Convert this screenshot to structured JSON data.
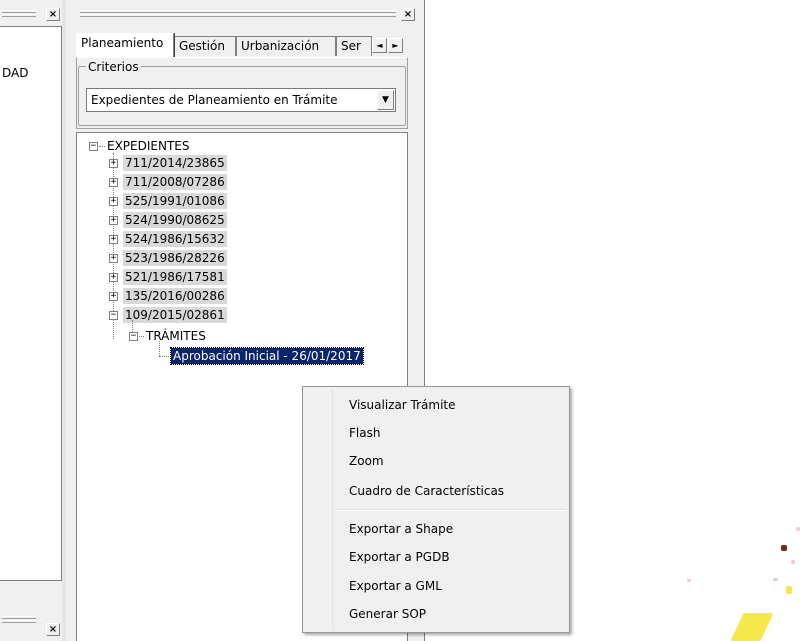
{
  "left_pane": {
    "close_glyph": "×",
    "clipped_text": "DAD"
  },
  "middle_pane": {
    "close_glyph": "×",
    "tabs": [
      {
        "label": "Planeamiento",
        "active": true
      },
      {
        "label": "Gestión",
        "active": false
      },
      {
        "label": "Urbanización",
        "active": false
      },
      {
        "label": "Ser",
        "active": false
      }
    ],
    "tab_scroll_left": "◄",
    "tab_scroll_right": "►",
    "criteria": {
      "group_label": "Criterios",
      "selected": "Expedientes de Planeamiento en Trámite",
      "dropdown_glyph": "▼"
    },
    "tree": {
      "root": {
        "label": "EXPEDIENTES",
        "toggle": "−"
      },
      "items": [
        {
          "label": "711/2014/23865",
          "toggle": "+"
        },
        {
          "label": "711/2008/07286",
          "toggle": "+"
        },
        {
          "label": "525/1991/01086",
          "toggle": "+"
        },
        {
          "label": "524/1990/08625",
          "toggle": "+"
        },
        {
          "label": "524/1986/15632",
          "toggle": "+"
        },
        {
          "label": "523/1986/28226",
          "toggle": "+"
        },
        {
          "label": "521/1986/17581",
          "toggle": "+"
        },
        {
          "label": "135/2016/00286",
          "toggle": "+"
        },
        {
          "label": "109/2015/02861",
          "toggle": "−"
        }
      ],
      "subfolder": {
        "label": "TRÁMITES",
        "toggle": "−"
      },
      "leaf": {
        "label": "Aprobación Inicial - 26/01/2017"
      }
    }
  },
  "context_menu": {
    "group1": [
      "Visualizar Trámite",
      "Flash",
      "Zoom",
      "Cuadro de Características"
    ],
    "group2": [
      "Exportar a Shape",
      "Exportar a PGDB",
      "Exportar a GML",
      "Generar SOP"
    ]
  },
  "colors": {
    "selection": "#0a246a",
    "highlight": "#d9d9d9",
    "map_yellow": "#f5e84a",
    "map_pink": "#f2c9c9"
  }
}
